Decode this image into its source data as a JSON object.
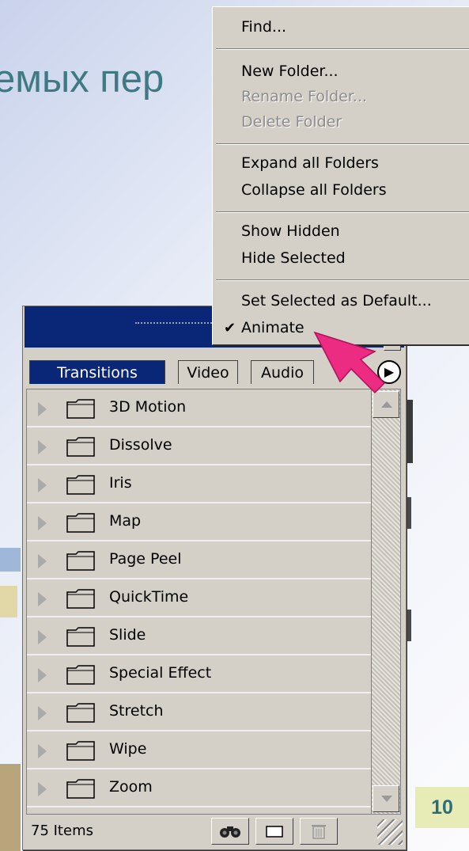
{
  "slide": {
    "heading_fragment": "емых пер",
    "page_number": "10"
  },
  "context_menu": {
    "items": [
      {
        "label": "Find...",
        "enabled": true
      },
      {
        "label": "New Folder...",
        "enabled": true
      },
      {
        "label": "Rename Folder...",
        "enabled": false
      },
      {
        "label": "Delete Folder",
        "enabled": false
      },
      {
        "label": "Expand all Folders",
        "enabled": true
      },
      {
        "label": "Collapse all Folders",
        "enabled": true
      },
      {
        "label": "Show Hidden",
        "enabled": true
      },
      {
        "label": "Hide Selected",
        "enabled": true
      },
      {
        "label": "Set Selected as Default...",
        "enabled": true
      },
      {
        "label": "Animate",
        "enabled": true,
        "checked": true
      }
    ],
    "check_mark": "✔"
  },
  "panel": {
    "tabs": [
      {
        "label": "Transitions",
        "active": true
      },
      {
        "label": "Video",
        "active": false
      },
      {
        "label": "Audio",
        "active": false
      }
    ],
    "folders": [
      "3D Motion",
      "Dissolve",
      "Iris",
      "Map",
      "Page Peel",
      "QuickTime",
      "Slide",
      "Special Effect",
      "Stretch",
      "Wipe",
      "Zoom"
    ],
    "status": "75 Items",
    "buttons": [
      {
        "name": "find-button",
        "icon": "binoculars-icon",
        "glyph": "🔍"
      },
      {
        "name": "new-folder-button",
        "icon": "folder-icon",
        "glyph": "▭"
      },
      {
        "name": "delete-button",
        "icon": "trash-icon",
        "glyph": "🗑"
      }
    ]
  },
  "colors": {
    "titlebar": "#0a2677",
    "panel_bg": "#d4d0c8",
    "pointer": "#ec2b83",
    "slide_heading": "#3f7a83",
    "page_badge_bg": "#e7ebb6"
  }
}
